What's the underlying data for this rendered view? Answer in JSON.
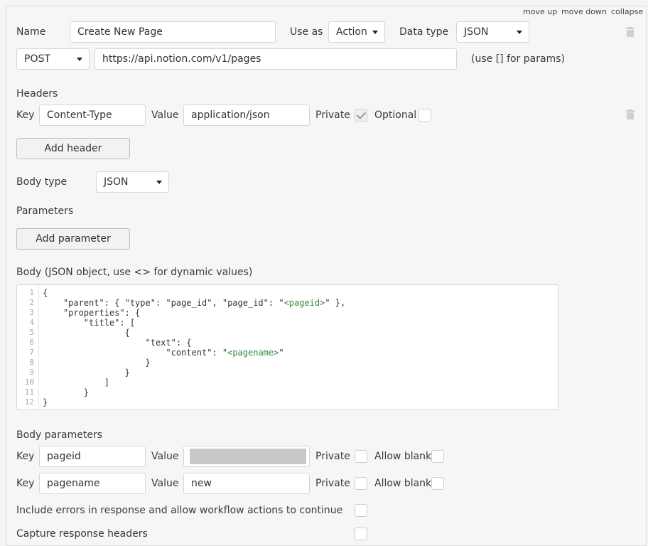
{
  "top_links": {
    "move_up": "move up",
    "move_down": "move down",
    "collapse": "collapse"
  },
  "call": {
    "name_label": "Name",
    "name_value": "Create New Page",
    "use_as_label": "Use as",
    "use_as_value": "Action",
    "data_type_label": "Data type",
    "data_type_value": "JSON",
    "method_value": "POST",
    "url_value": "https://api.notion.com/v1/pages",
    "url_hint": "(use [] for params)"
  },
  "headers": {
    "title": "Headers",
    "key_label": "Key",
    "key_value": "Content-Type",
    "value_label": "Value",
    "value_value": "application/json",
    "private_label": "Private",
    "private_checked": true,
    "optional_label": "Optional",
    "optional_checked": false,
    "add_button": "Add header"
  },
  "body_type": {
    "label": "Body type",
    "value": "JSON"
  },
  "parameters": {
    "title": "Parameters",
    "add_button": "Add parameter"
  },
  "body": {
    "label": "Body (JSON object, use <> for dynamic values)",
    "line_numbers": [
      "1",
      "2",
      "3",
      "4",
      "5",
      "6",
      "7",
      "8",
      "9",
      "10",
      "11",
      "12"
    ],
    "lines": {
      "l1": "{",
      "l2_a": "    \"parent\": { \"type\": \"page_id\", \"page_id\": \"",
      "l2_dyn": "<pageid>",
      "l2_b": "\" },",
      "l3": "    \"properties\": {",
      "l4": "        \"title\": [",
      "l5": "                {",
      "l6": "                    \"text\": {",
      "l7_a": "                        \"content\": \"",
      "l7_dyn": "<pagename>",
      "l7_b": "\"",
      "l8": "                    }",
      "l9": "                }",
      "l10": "            ]",
      "l11": "        }",
      "l12": "}"
    }
  },
  "body_parameters": {
    "title": "Body parameters",
    "rows": [
      {
        "key_label": "Key",
        "key_value": "pageid",
        "value_label": "Value",
        "value_value": "",
        "private_label": "Private",
        "allow_blank_label": "Allow blank"
      },
      {
        "key_label": "Key",
        "key_value": "pagename",
        "value_label": "Value",
        "value_value": "new",
        "private_label": "Private",
        "allow_blank_label": "Allow blank"
      }
    ]
  },
  "options": {
    "include_errors_label": "Include errors in response and allow workflow actions to continue",
    "capture_headers_label": "Capture response headers"
  }
}
